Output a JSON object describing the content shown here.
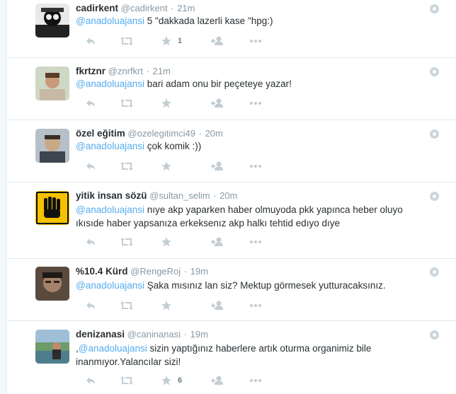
{
  "tweets": [
    {
      "fullname": "cadirkent",
      "username": "@cadirkent",
      "time": "21m",
      "mention": "@anadoluajansi",
      "body": " 5 \"dakkada lazerli kase \"hpg:)",
      "favorite_count": "1"
    },
    {
      "fullname": "fkrtznr",
      "username": "@znrfkrt",
      "time": "21m",
      "mention": "@anadoluajansi",
      "body": " bari adam onu bir peçeteye yazar!",
      "favorite_count": ""
    },
    {
      "fullname": "özel eğitim",
      "username": "@ozelegitimci49",
      "time": "20m",
      "mention": "@anadoluajansi",
      "body": " çok komik :))",
      "favorite_count": ""
    },
    {
      "fullname": "yitik insan sözü",
      "username": "@sultan_selim",
      "time": "20m",
      "mention": "@anadoluajansi",
      "body": " nıye akp yaparken haber olmuyoda pkk yapınca heber oluyo ıkısıde haber yapsanıza erkeksenız akp halkı tehtid edıyo dıye",
      "favorite_count": ""
    },
    {
      "fullname": "%10.4 Kürd",
      "username": "@RengeRoj",
      "time": "19m",
      "mention": "@anadoluajansi",
      "body": " Şaka mısınız lan siz? Mektup görmesek yutturacaksınız.",
      "favorite_count": ""
    },
    {
      "fullname": "denizanasi",
      "username": "@caninanasi",
      "time": "19m",
      "prefix": ",",
      "mention": "@anadoluajansi",
      "body": " sizin yaptığınız haberlere artık oturma organimiz bile inanmıyor.Yalancılar sizi!",
      "favorite_count": "6"
    }
  ],
  "separator": "·",
  "colors": {
    "link": "#55acee",
    "muted": "#8899a6",
    "action_icon": "#c2cdd4",
    "border": "#e1e8ed"
  },
  "icons": [
    "reply-icon",
    "retweet-icon",
    "favorite-star-icon",
    "follow-icon",
    "more-icon",
    "tweet-menu-icon"
  ]
}
